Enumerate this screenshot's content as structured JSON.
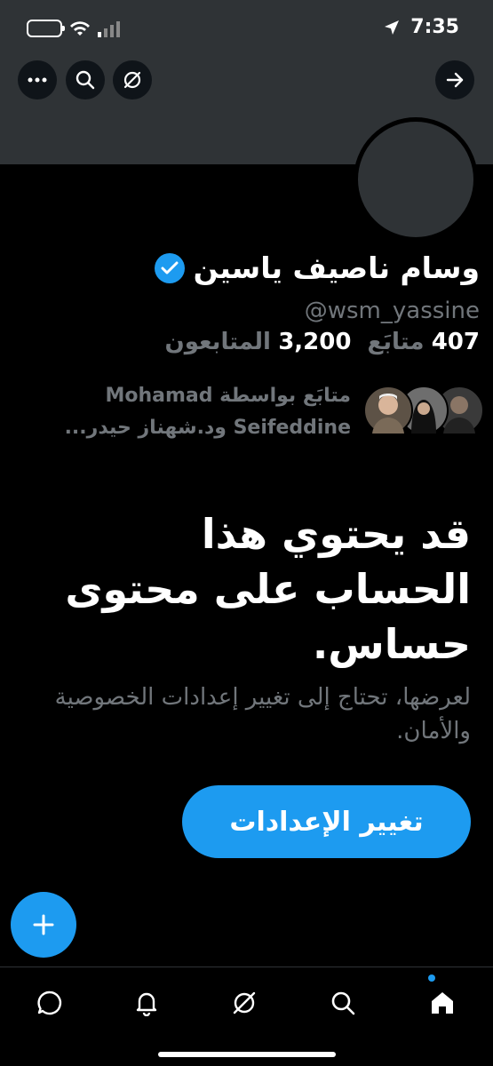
{
  "status_bar": {
    "time": "7:35"
  },
  "profile": {
    "name": "وسام ناصيف ياسين",
    "handle": "@wsm_yassine",
    "following_count": "407",
    "following_label": "متابَع",
    "followers_count": "3,200",
    "followers_label": "المتابعون",
    "followed_by_line1": "متابَع بواسطة Mohamad",
    "followed_by_line2": "Seifeddine ود.شهناز حيدر..."
  },
  "warning": {
    "headline": "قد يحتوي هذا الحساب على محتوى حساس.",
    "subtext": "لعرضها، تحتاج إلى تغيير إعدادات الخصوصية والأمان.",
    "button_label": "تغيير الإعدادات"
  },
  "fab": {
    "label": "+"
  },
  "colors": {
    "accent": "#1d9bf0",
    "background": "#000000",
    "muted": "#71767b",
    "banner": "#2f3336"
  },
  "icons": [
    "more-icon",
    "search-icon",
    "grok-icon",
    "forward-arrow-icon",
    "messages-icon",
    "bell-icon",
    "grok-nav-icon",
    "search-nav-icon",
    "home-icon"
  ]
}
